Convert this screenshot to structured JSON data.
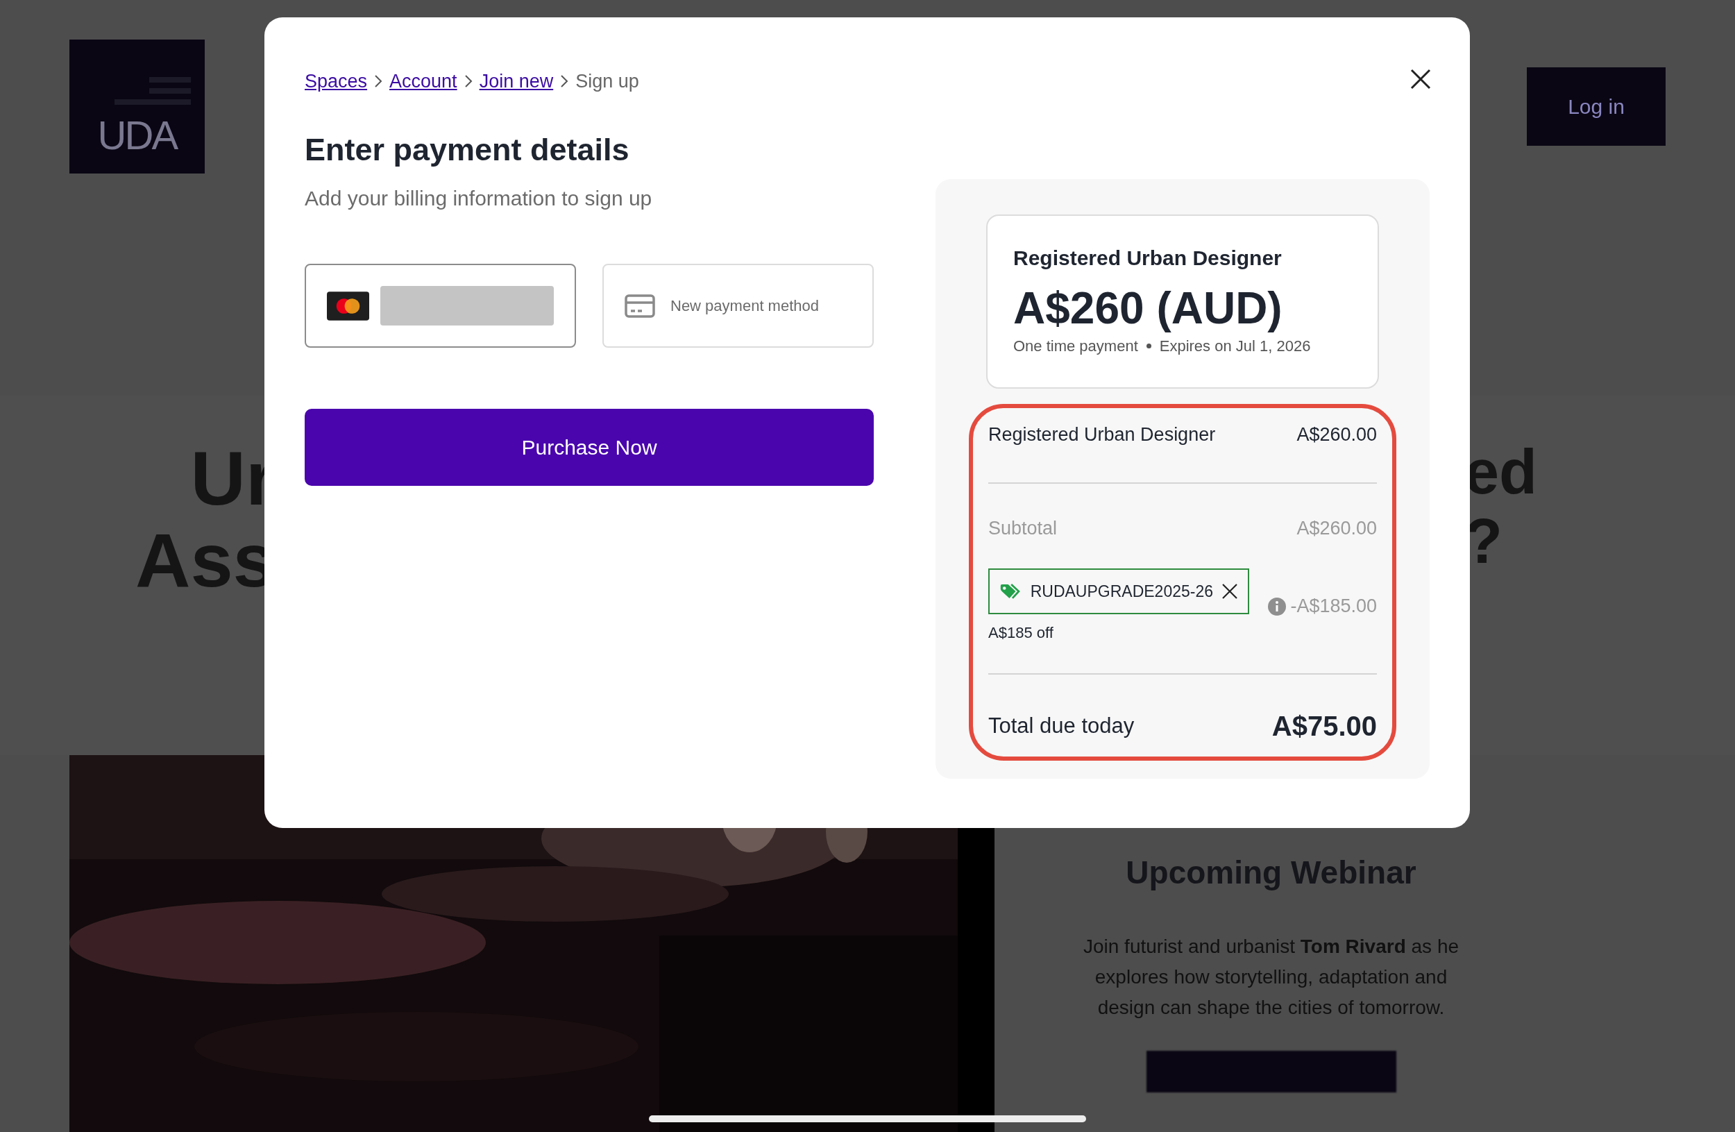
{
  "backdrop": {
    "logo": "UDA",
    "login_button": "Log in",
    "heading_left": [
      "Ur",
      "Ass"
    ],
    "heading_right": [
      "ed",
      "?"
    ],
    "webinar": {
      "title": "Upcoming Webinar",
      "text": "Join futurist and urbanist **Tom Rivard** as he explores how storytelling, adaptation and design can shape the cities of tomorrow."
    }
  },
  "dialog": {
    "breadcrumb": [
      {
        "label": "Spaces",
        "kind": "link"
      },
      {
        "label": "Account",
        "kind": "link"
      },
      {
        "label": "Join new",
        "kind": "link"
      },
      {
        "label": "Sign up",
        "kind": "current"
      }
    ],
    "title": "Enter payment details",
    "subtitle": "Add your billing information to sign up",
    "payment_methods": [
      {
        "kind": "saved_card",
        "selected": true
      },
      {
        "kind": "new",
        "label": "New payment method",
        "selected": false
      }
    ],
    "purchase_button": "Purchase Now",
    "plan": {
      "name": "Registered Urban Designer",
      "price": "A$260 (AUD)",
      "payment_type": "One time payment",
      "expires": "Expires on Jul 1, 2026"
    },
    "summary": {
      "highlighted": true,
      "line_item": {
        "name": "Registered Urban Designer",
        "amount": "A$260.00"
      },
      "subtotal": {
        "label": "Subtotal",
        "amount": "A$260.00"
      },
      "coupon": {
        "code": "RUDAUPGRADE2025-26",
        "note": "A$185 off",
        "amount": "-A$185.00"
      },
      "total": {
        "label": "Total due today",
        "amount": "A$75.00"
      }
    }
  }
}
